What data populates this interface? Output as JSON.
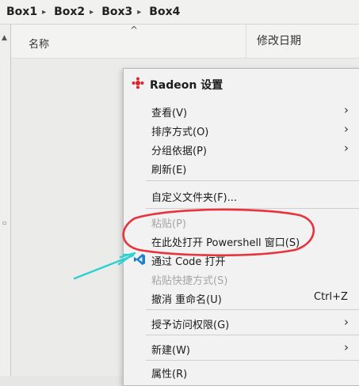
{
  "breadcrumb": [
    "Box1",
    "Box2",
    "Box3",
    "Box4"
  ],
  "breadcrumb_separator": "▸",
  "column_headers": {
    "name": "名称",
    "sort_indicator": "^",
    "modified": "修改日期"
  },
  "menu": {
    "radeon": "Radeon 设置",
    "view": "查看(V)",
    "sort": "排序方式(O)",
    "group": "分组依据(P)",
    "refresh": "刷新(E)",
    "customize": "自定义文件夹(F)...",
    "paste": "粘贴(P)",
    "open_powershell": "在此处打开 Powershell 窗口(S)",
    "open_vscode": "通过 Code 打开",
    "paste_shortcut": "粘贴快捷方式(S)",
    "undo_rename": "撤消 重命名(U)",
    "undo_shortcut": "Ctrl+Z",
    "grant_access": "授予访问权限(G)",
    "new": "新建(W)",
    "properties": "属性(R)"
  },
  "annotation_colors": {
    "highlight_ellipse": "#e8323c",
    "pointer_arrow": "#2fd0d2"
  }
}
